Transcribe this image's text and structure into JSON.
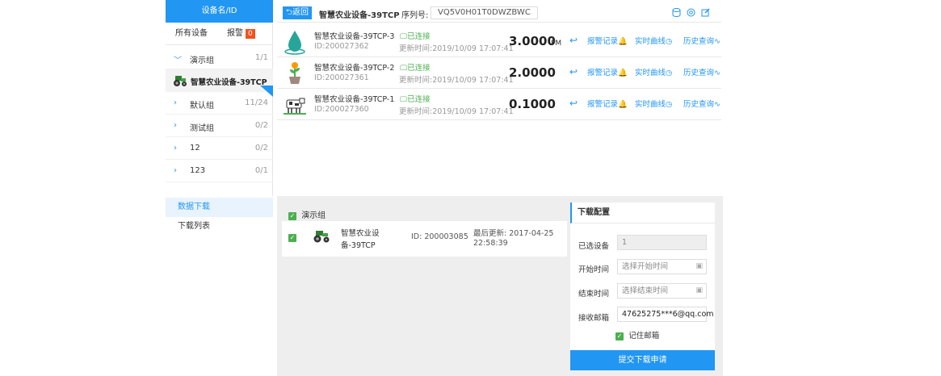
{
  "sidebar": {
    "header": "设备名/ID",
    "tabs": {
      "all": "所有设备",
      "alarm": "报警",
      "alarm_count": "0"
    },
    "groups": [
      {
        "name": "演示组",
        "count": "1/1",
        "expanded": true
      },
      {
        "name": "默认组",
        "count": "11/24"
      },
      {
        "name": "测试组",
        "count": "0/2"
      },
      {
        "name": "12",
        "count": "0/2"
      },
      {
        "name": "123",
        "count": "0/1"
      }
    ],
    "selected_device": "智慧农业设备-39TCP",
    "nav": [
      "数据下载",
      "下载列表"
    ]
  },
  "toolbar": {
    "back_label": "返回",
    "device_name": "智慧农业设备-39TCP",
    "serial_label": "序列号:",
    "serial_value": "VQ5V0H01T0DWZBWC"
  },
  "devices": [
    {
      "name": "智慧农业设备-39TCP-3",
      "id": "ID:200027362",
      "status": "已连接",
      "updated": "更新时间:2019/10/09 17:07:41",
      "value": "3.0000",
      "unit": "PM",
      "icon": "water-drop-icon"
    },
    {
      "name": "智慧农业设备-39TCP-2",
      "id": "ID:200027361",
      "status": "已连接",
      "updated": "更新时间:2019/10/09 17:07:41",
      "value": "2.0000",
      "unit": ".",
      "icon": "potted-plant-icon"
    },
    {
      "name": "智慧农业设备-39TCP-1",
      "id": "ID:200027360",
      "status": "已连接",
      "updated": "更新时间:2019/10/09 17:07:41",
      "value": "0.1000",
      "unit": ".",
      "icon": "cow-icon"
    }
  ],
  "row_links": {
    "alarm": "报警记录",
    "realtime": "实时曲线",
    "history": "历史查询"
  },
  "download": {
    "group_name": "演示组",
    "device_name_line1": "智慧农业设",
    "device_name_line2": "备-39TCP",
    "device_id": "ID: 200003085",
    "last_update_line1": "最后更新: 2017-04-25",
    "last_update_line2": "22:58:39"
  },
  "config": {
    "title": "下载配置",
    "selected_label": "已选设备",
    "selected_value": "1",
    "start_label": "开始时间",
    "start_placeholder": "选择开始时间",
    "end_label": "结束时间",
    "end_placeholder": "选择结束时间",
    "email_label": "接收邮箱",
    "email_value": "47625275***6@qq.com",
    "remember_label": "记住邮箱",
    "submit_label": "提交下载申请"
  },
  "colors": {
    "accent": "#2196f3",
    "success": "#4caf50",
    "badge": "#f4511e"
  }
}
